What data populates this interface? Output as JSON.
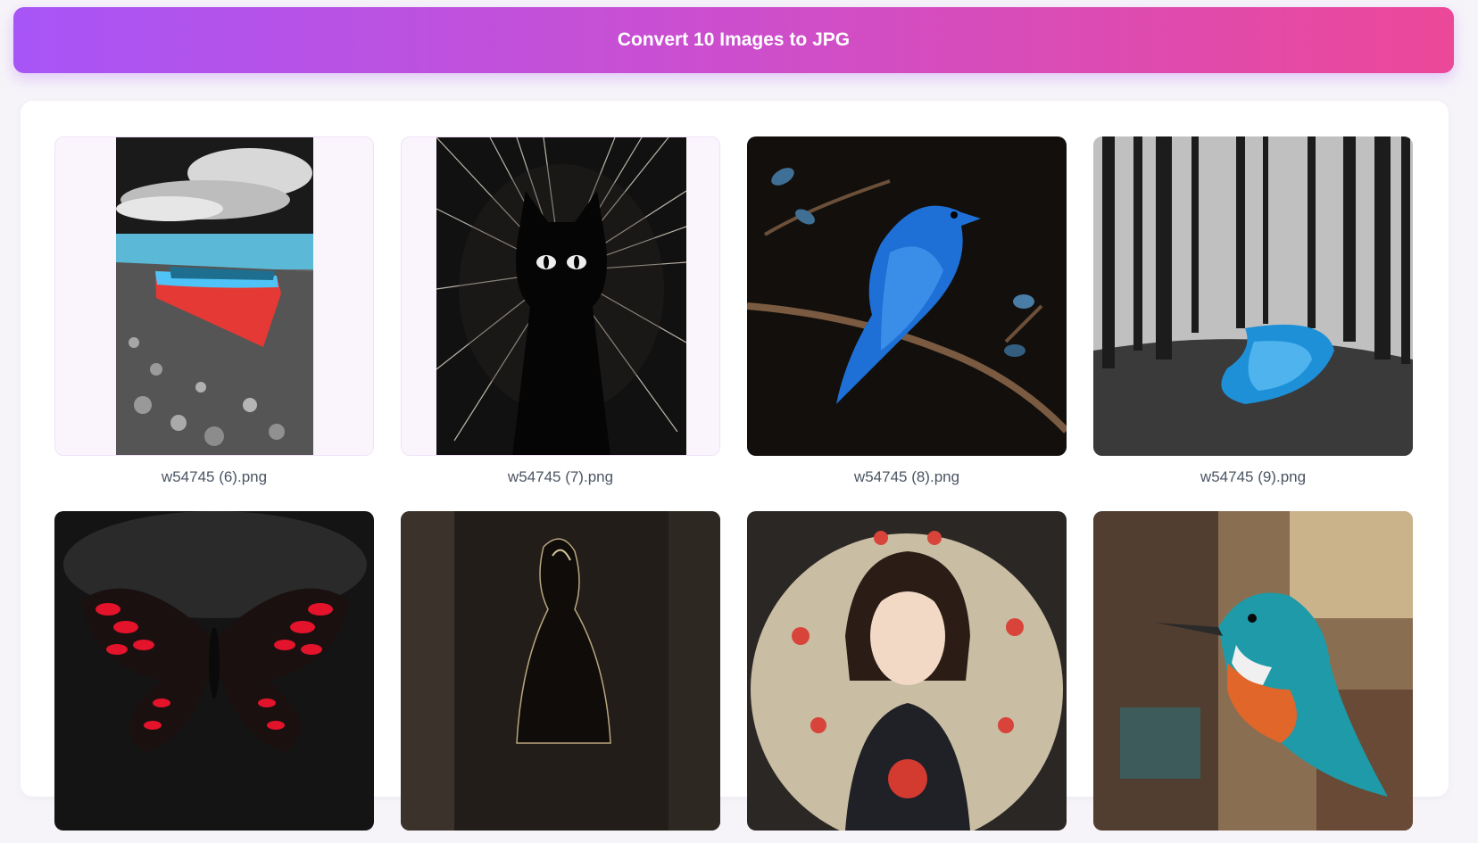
{
  "convert_button": {
    "label": "Convert 10 Images to JPG"
  },
  "images": [
    {
      "filename": "w54745 (6).png",
      "subject": "rowboat on pebble beach"
    },
    {
      "filename": "w54745 (7).png",
      "subject": "black cat silhouette"
    },
    {
      "filename": "w54745 (8).png",
      "subject": "blue bird on branch"
    },
    {
      "filename": "w54745 (9).png",
      "subject": "forest with blue stream"
    },
    {
      "filename": "",
      "subject": "red butterfly"
    },
    {
      "filename": "",
      "subject": "dark figure"
    },
    {
      "filename": "",
      "subject": "portrait of woman"
    },
    {
      "filename": "",
      "subject": "colorful kingfisher"
    }
  ],
  "colors": {
    "gradient_start": "#a855f7",
    "gradient_end": "#ec4899"
  }
}
